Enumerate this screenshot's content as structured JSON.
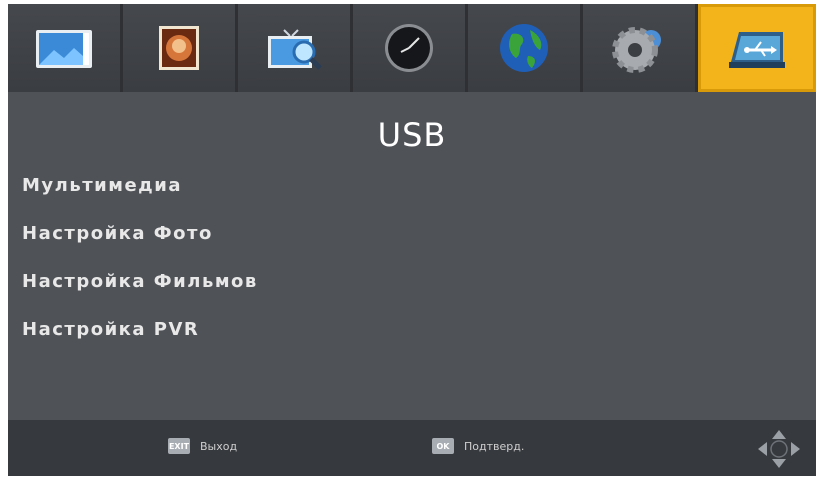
{
  "tabs": [
    {
      "name": "tv-picture-tab",
      "icon": "picture-icon",
      "active": false
    },
    {
      "name": "photo-tab",
      "icon": "photo-icon",
      "active": false
    },
    {
      "name": "channel-search-tab",
      "icon": "search-tv-icon",
      "active": false
    },
    {
      "name": "time-tab",
      "icon": "clock-icon",
      "active": false
    },
    {
      "name": "language-tab",
      "icon": "globe-icon",
      "active": false
    },
    {
      "name": "system-tab",
      "icon": "gear-disc-icon",
      "active": false
    },
    {
      "name": "usb-tab",
      "icon": "usb-icon",
      "active": true
    }
  ],
  "header": {
    "title": "USB"
  },
  "menu": {
    "items": [
      {
        "label": "Мультимедиа"
      },
      {
        "label": "Настройка Фото"
      },
      {
        "label": "Настройка Фильмов"
      },
      {
        "label": "Настройка PVR"
      }
    ]
  },
  "footer": {
    "exit_key": "EXIT",
    "exit_label": "Выход",
    "ok_key": "OK",
    "ok_label": "Подтверд."
  },
  "colors": {
    "accent": "#f3b31a",
    "background": "#4f5257",
    "bars": "#36393d"
  }
}
